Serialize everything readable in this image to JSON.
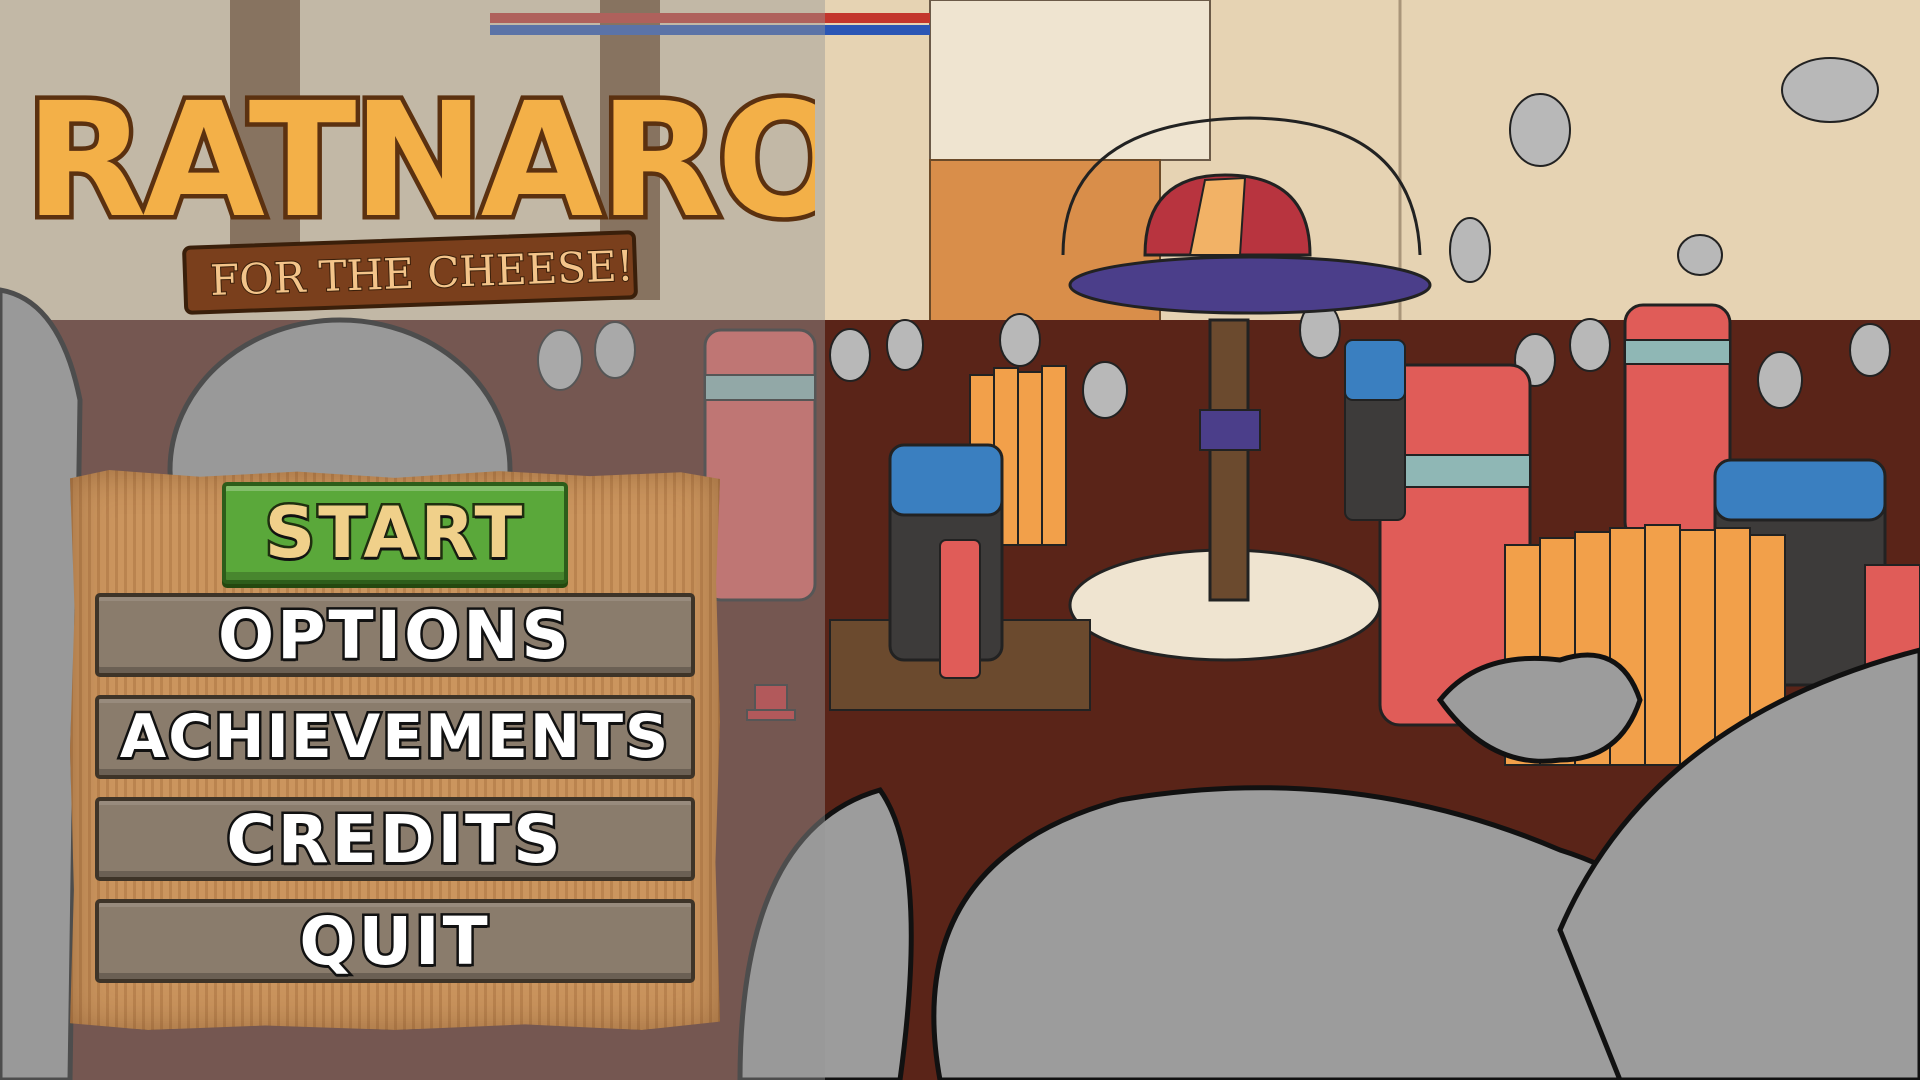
{
  "game": {
    "title": "RATNAROK",
    "subtitle": "FOR THE CHEESE!"
  },
  "menu": {
    "start": "START",
    "options": "OPTIONS",
    "achievements": "ACHIEVEMENTS",
    "credits": "CREDITS",
    "quit": "QUIT"
  },
  "colors": {
    "start_button": "#5aa83a",
    "menu_button": "#8a7c6c",
    "board": "#c8915a",
    "floor": "#5a2418",
    "wall": "#e6d3b3",
    "logo_fill": "#f3b048"
  },
  "icons": [
    "cheese-cushion-icon",
    "battery-icon",
    "lighter-icon",
    "thumbtack-icon",
    "rat-icon"
  ]
}
